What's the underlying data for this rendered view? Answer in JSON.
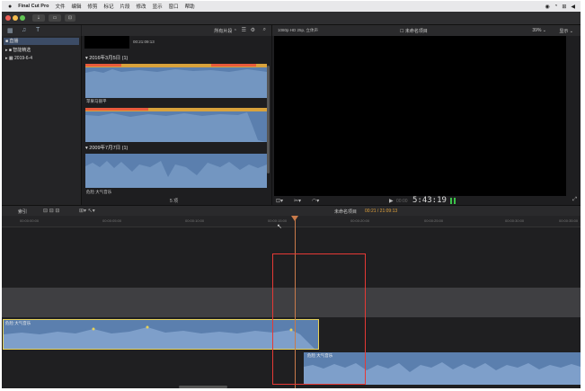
{
  "menubar": {
    "apple_icon": "apple-logo",
    "app_name": "Final Cut Pro",
    "items": [
      "文件",
      "编辑",
      "修剪",
      "标记",
      "片段",
      "修改",
      "显示",
      "窗口",
      "帮助"
    ]
  },
  "libraries": {
    "items": [
      {
        "label": "■ 直播"
      },
      {
        "label": "▸ ■ 智能精选"
      },
      {
        "label": "▸ ▦ 2019-6-4"
      }
    ]
  },
  "browser": {
    "filter_label": "所有片段 ⌃",
    "top_clip_time": "00:21:09:13",
    "date_groups": [
      {
        "label": "▾ 2016年3月5日  (1)",
        "clip_label": "苹果马丽平"
      },
      {
        "label": "▾ 2009年7月7日  (1)",
        "clip_label": "危险 大气音乐"
      }
    ],
    "footer_count": "5 项"
  },
  "viewer": {
    "format": "1080p HD 25p, 立体声",
    "title": "☐ 未命名项目",
    "zoom": "39% ⌄",
    "display_menu": "显示 ⌄",
    "timecode": "5:43:19",
    "small_timecode": "00:00"
  },
  "timeline": {
    "index_label": "索引",
    "project_label": "未命名项目",
    "duration": "00:21 / 21:09:13",
    "ruler_ticks": [
      "00:00:00:00",
      "00:00:05:00",
      "00:00:10:00",
      "00:00:15:00",
      "00:00:20:00",
      "00:00:25:00",
      "00:00:30:00",
      "00:00:35:00"
    ],
    "clip_a_label": "危险 大气音乐",
    "clip_b_label": "危险 大气音乐"
  },
  "colors": {
    "accent": "#e53935",
    "clip": "#5b7fae",
    "selection": "#e6d25a",
    "playhead": "#c87a4a"
  }
}
